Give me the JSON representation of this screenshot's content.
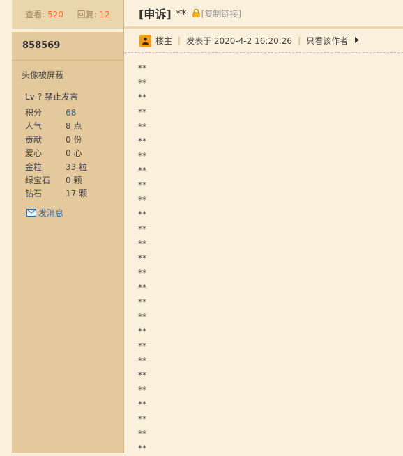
{
  "sidebar": {
    "views_label": "查看:",
    "views_count": "520",
    "replies_label": "回复:",
    "replies_count": "12",
    "username": "858569",
    "avatar_note": "头像被屏蔽",
    "level": "Lv-? 禁止发言",
    "info": [
      {
        "key": "积分",
        "value": "68",
        "highlight": true
      },
      {
        "key": "人气",
        "value": "8 点"
      },
      {
        "key": "贡献",
        "value": "0 份"
      },
      {
        "key": "爱心",
        "value": "0 心"
      },
      {
        "key": "金粒",
        "value": "33 粒"
      },
      {
        "key": "绿宝石",
        "value": "0 颗"
      },
      {
        "key": "钻石",
        "value": "17 颗"
      }
    ],
    "message_link": "发消息"
  },
  "post": {
    "title_tag": "[申诉]",
    "title_text": "**",
    "copy_link": "[复制链接]",
    "author_role": "楼主",
    "posted_at": "发表于 2020-4-2 16:20:26",
    "only_author": "只看该作者",
    "lines": [
      "**",
      "**",
      "**",
      "**",
      "**",
      "**",
      "**",
      "**",
      "**",
      "**",
      "**",
      "**",
      "**",
      "**",
      "**",
      "**",
      "**",
      "**",
      "**",
      "**",
      "**",
      "**",
      "**",
      "**",
      "**",
      "**",
      "**"
    ]
  },
  "colors": {
    "accent": "#ff6a2a",
    "link": "#336699",
    "badge": "#f39a1d",
    "sidebar_bg": "#e3c99b",
    "page_bg": "#faf0db"
  }
}
